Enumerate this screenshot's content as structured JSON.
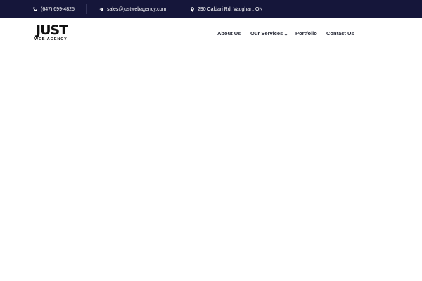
{
  "topbar": {
    "phone": "(647) 699-4825",
    "email": "sales@justwebagency.com",
    "address": "290 Caldari Rd, Vaughan, ON",
    "background": "#15163a",
    "icons": {
      "phone": "phone-icon",
      "email": "paper-plane-icon",
      "address": "map-marker-icon"
    }
  },
  "logo": {
    "main": "JUST",
    "sub": "WEB AGENCY"
  },
  "nav": {
    "items": [
      {
        "label": "About Us"
      },
      {
        "label": "Our Services"
      },
      {
        "label": "Portfolio"
      },
      {
        "label": "Contact Us"
      }
    ],
    "dropdown_icon": "chevron-down-icon"
  }
}
